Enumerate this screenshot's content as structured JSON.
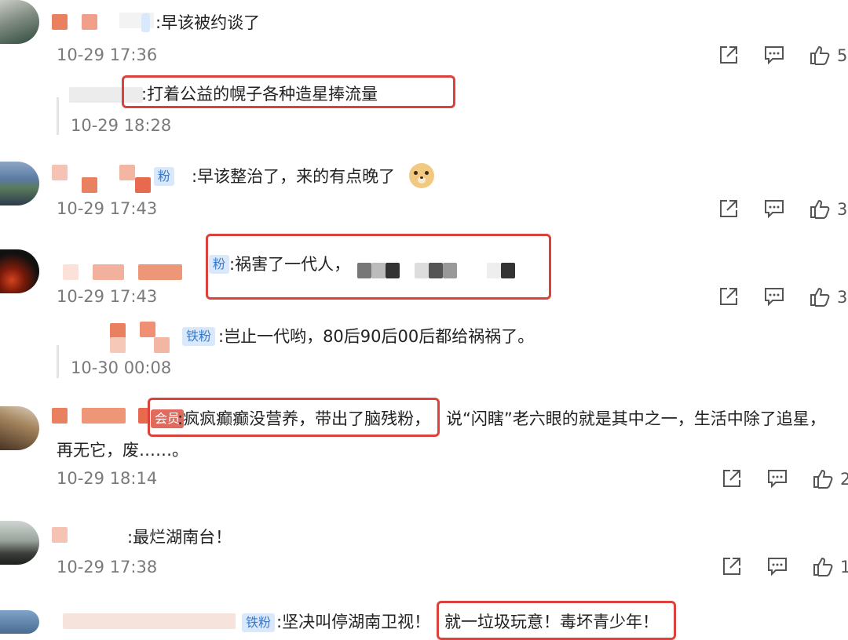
{
  "comments": [
    {
      "text": ":早该被约谈了",
      "time": "10-29 17:36",
      "likes": "5"
    },
    {
      "text": ":打着公益的幌子各种造星捧流量",
      "time": "10-29 18:28"
    },
    {
      "badge": "粉",
      "text": ":早该整治了，来的有点晚了",
      "time": "10-29 17:43",
      "likes": "3"
    },
    {
      "badge": "粉",
      "text": ":祸害了一代人，",
      "time": "10-29 17:43",
      "likes": "3"
    },
    {
      "badge": "铁粉",
      "text": ":岂止一代哟，80后90后00后都给祸祸了。",
      "time": "10-30 00:08"
    },
    {
      "badge": "会员",
      "text_boxed": ":疯疯癫癫没营养，带出了脑残粉，",
      "text_rest": "说“闪瞎”老六眼的就是其中之一，生活中除了追星，",
      "text_line2": "再无它，废……。",
      "time": "10-29 18:14",
      "likes": "2"
    },
    {
      "text": ":最烂湖南台！",
      "time": "10-29 17:38",
      "likes": "1"
    },
    {
      "badge": "铁粉",
      "text": ":坚决叫停湖南卫视！",
      "text_boxed": "就一垃圾玩意！毒坏青少年！"
    }
  ],
  "icons": {
    "share": "share-icon",
    "comment": "comment-icon",
    "like": "thumbs-up-icon"
  },
  "colors": {
    "highlight_border": "#d9433b",
    "badge_blue": "#3d78c5",
    "badge_red": "#e06a5c",
    "timestamp": "#7a7a7a"
  }
}
